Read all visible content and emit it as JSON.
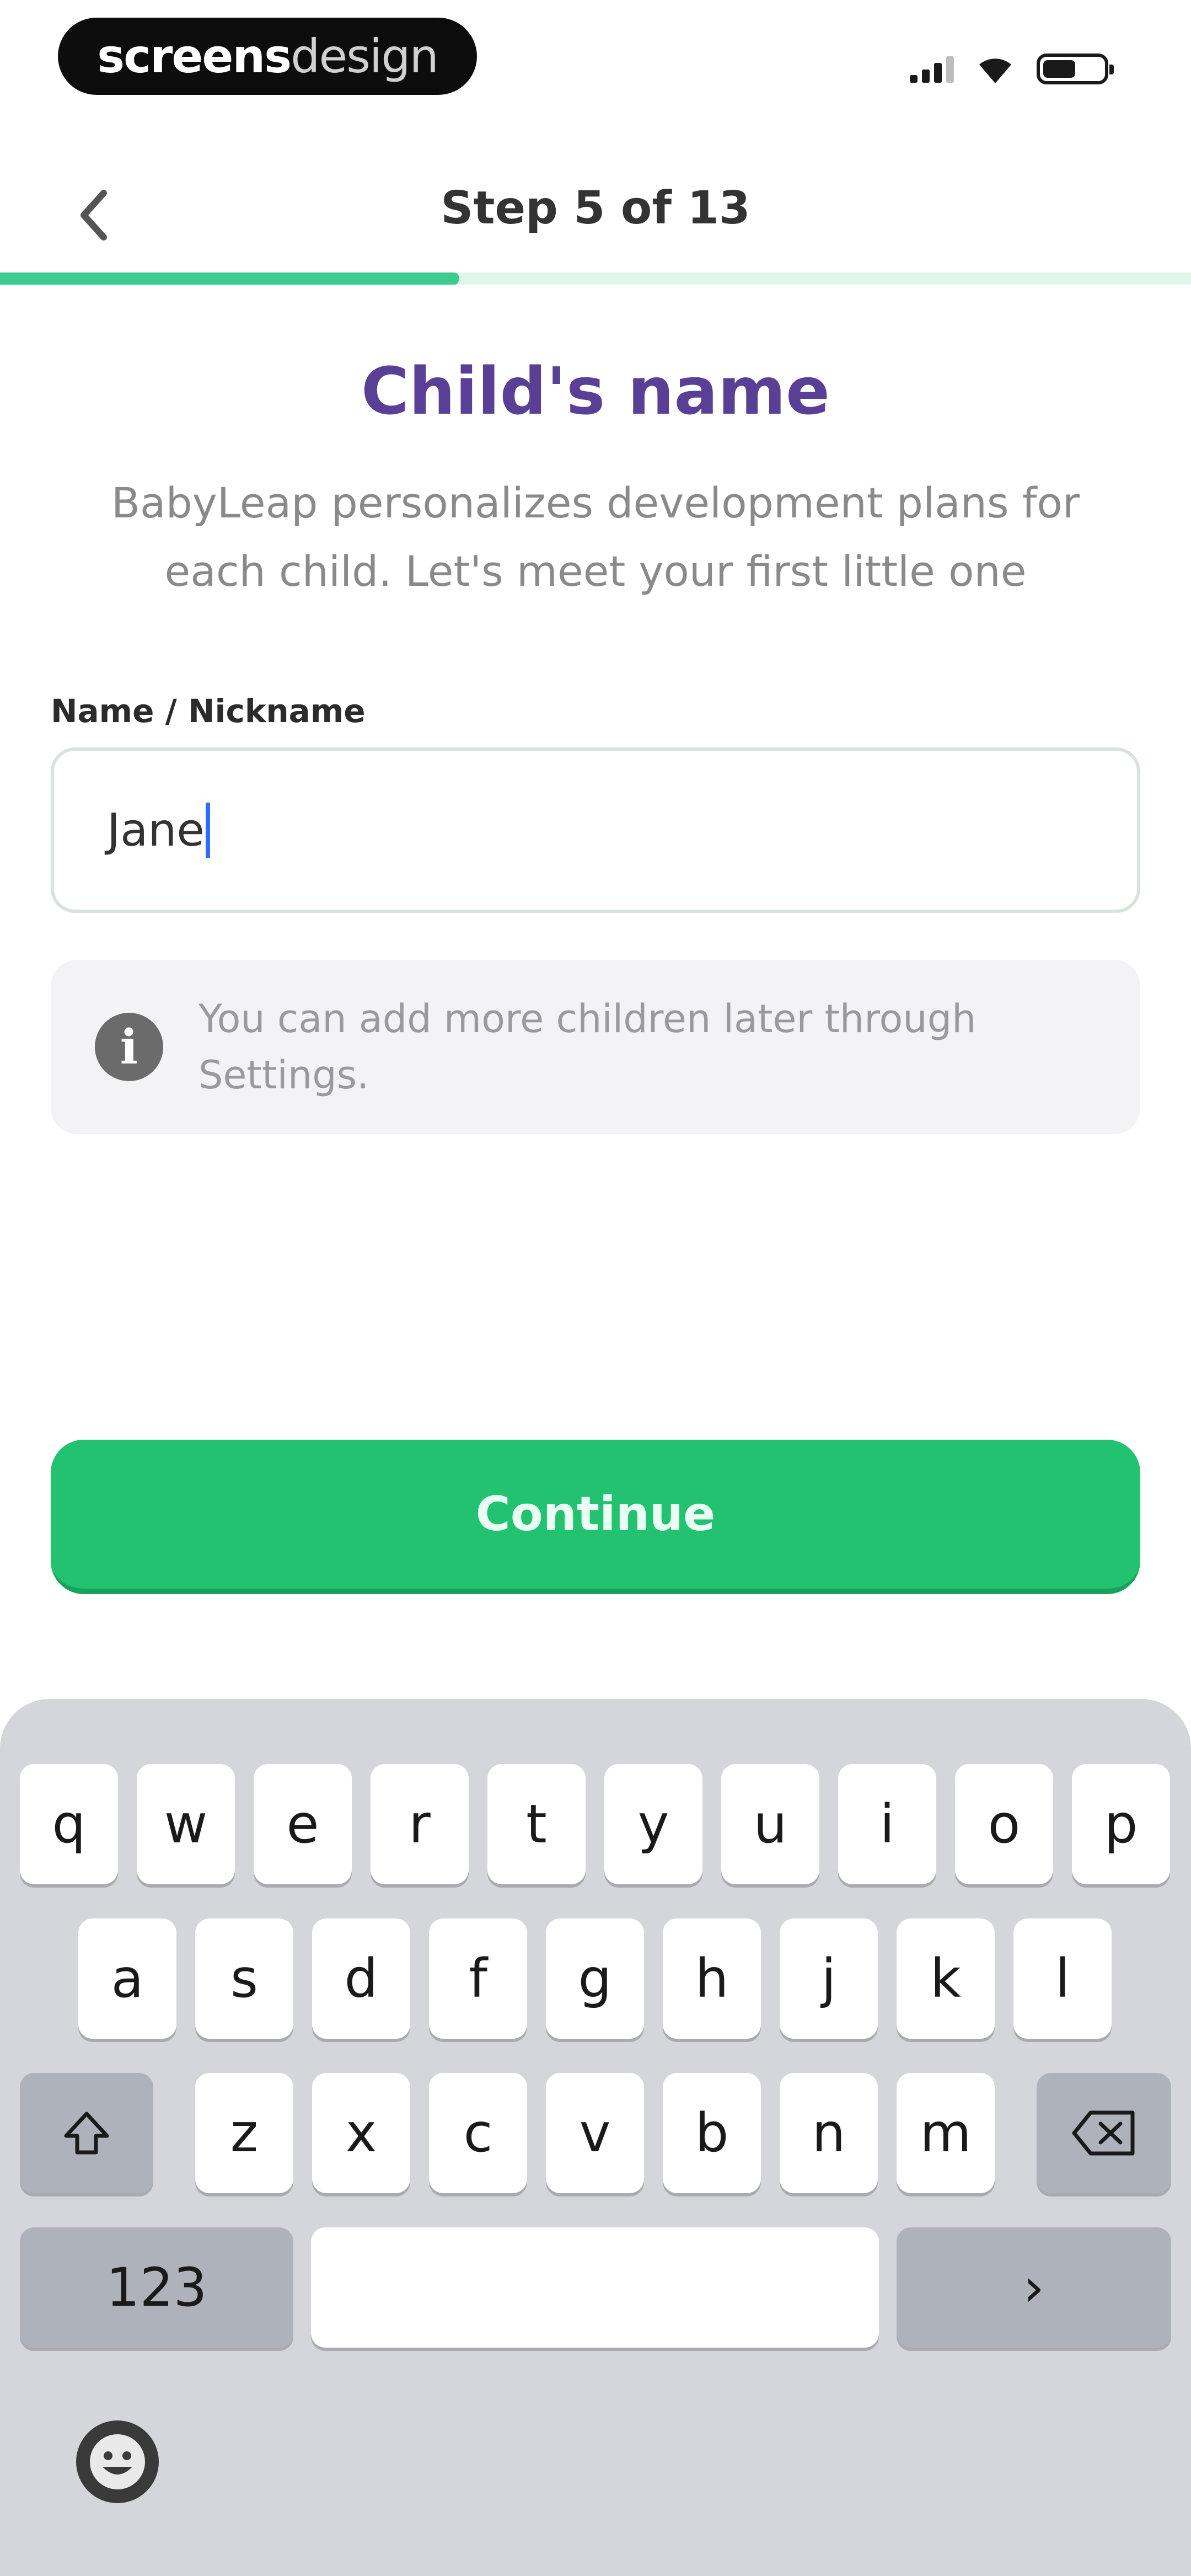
{
  "status_bar": {
    "brand_part1": "screens",
    "brand_part2": "design",
    "icons": [
      "cellular-signal-icon",
      "wifi-icon",
      "battery-icon"
    ]
  },
  "nav": {
    "back_icon": "chevron-left-icon",
    "step_label": "Step 5 of 13",
    "progress_fraction": 0.385
  },
  "page": {
    "title": "Child's name",
    "subtitle": "BabyLeap personalizes development plans for each child. Let's meet your first little one"
  },
  "form": {
    "name_label": "Name / Nickname",
    "name_value": "Jane"
  },
  "info": {
    "icon": "info-icon",
    "text": "You can add more children later through Settings."
  },
  "continue_label": "Continue",
  "keyboard": {
    "row1": [
      "q",
      "w",
      "e",
      "r",
      "t",
      "y",
      "u",
      "i",
      "o",
      "p"
    ],
    "row2": [
      "a",
      "s",
      "d",
      "f",
      "g",
      "h",
      "j",
      "k",
      "l"
    ],
    "row3": [
      "z",
      "x",
      "c",
      "v",
      "b",
      "n",
      "m"
    ],
    "numbers_label": "123",
    "return_label": "›",
    "shift_icon": "shift-icon",
    "delete_icon": "backspace-icon",
    "emoji_icon": "emoji-icon"
  },
  "colors": {
    "title": "#5a3f96",
    "primary_button": "#22c271",
    "progress": "#3dcc8f"
  }
}
